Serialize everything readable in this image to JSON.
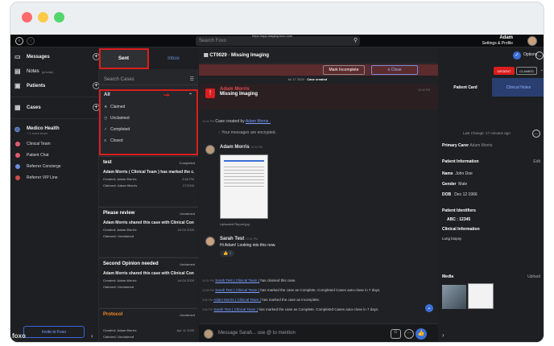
{
  "topbar": {
    "search_placeholder": "Search Foxo",
    "url": "https://app-staging.foxo.com",
    "user_name": "Adam",
    "user_sub": "Settings & Profile"
  },
  "sidebar": {
    "messages": "Messages",
    "notes": "Notes",
    "notes_sub": "(private)",
    "patients": "Patients",
    "cases": "Cases",
    "org_name": "Medico Health",
    "org_sub": "+ 1 more team",
    "teams": [
      {
        "label": "Clinical Team",
        "color": "#e45a6e"
      },
      {
        "label": "Patient Chat",
        "color": "#e45a6e"
      },
      {
        "label": "Referrer Concierge",
        "color": "#6b8de0"
      },
      {
        "label": "Referrer VIP Line",
        "color": "#d14a4a"
      }
    ],
    "invite": "Invite to Foxo",
    "logo": "foxo"
  },
  "cases": {
    "tab_sent": "Sent",
    "tab_inbox": "Inbox",
    "search_placeholder": "Search Cases",
    "filter_all": "All",
    "filters": [
      "Claimed",
      "Unclaimed",
      "Completed",
      "Closed"
    ],
    "cards": [
      {
        "title": "test",
        "status": "Completed",
        "msg": "Adam Morris ( Clinical Team ) has marked the c...",
        "created": "Created: Adam Morris",
        "claimed": "Claimed: Adam Morris",
        "time": "3:56 PM",
        "id": "CT0030"
      },
      {
        "title": "Please review",
        "status": "Unclaimed",
        "msg": "Adam Morris shared this case with Clinical Con...",
        "created": "Created: Adam Morris",
        "claimed": "Claimed: Unclaimed",
        "time": "Jul 04 2025",
        "id": ""
      },
      {
        "title": "Second Opinion needed",
        "status": "Unclaimed",
        "msg": "Adam Morris shared this case with Clinical Con...",
        "created": "Created: Adam Morris",
        "claimed": "Claimed: Unclaimed",
        "time": "Jul 04 2025",
        "id": ""
      },
      {
        "title": "Protocol",
        "status": "Unclaimed",
        "msg": "",
        "created": "Created: Adam Morris",
        "claimed": "Claimed: Unclaimed",
        "time": "Apr 11 2025",
        "id": ""
      }
    ]
  },
  "chat": {
    "title": "CT0029 · Missing Imaging",
    "options": "Options",
    "mark_incomplete": "Mark Incomplete",
    "close": "Close",
    "date_sep": "Jul 17 2025",
    "date_sep_label": "Case created",
    "m1_name": "Adam Morris",
    "m1_text": "Missing Imaging",
    "m1_time": "10:30 PM",
    "sys1_time": "10:32 PM",
    "sys1_text": "Case created by",
    "sys1_link": "Adam Morris .",
    "encrypted": "Your messages are encrypted.",
    "m2_name": "Adam Morris",
    "m2_time": "10:32 PM",
    "file_name": "Uploaded Report.jpg",
    "m3_name": "Sarah Test",
    "m3_time": "10:41 PM",
    "m3_text": "Hi Adam! Looking into this now.",
    "reaction_count": "1",
    "events": [
      {
        "time": "10:41 PM",
        "who": "Sarah Test ( Clinical Team )",
        "text": "has claimed this case."
      },
      {
        "time": "10:56 PM",
        "who": "Sarah Test ( Clinical Team )",
        "text": "has marked the case as Complete. Completed Cases auto-close in 7 days."
      },
      {
        "time": "3:56 PM",
        "who": "Adam Morris ( Clinical Team )",
        "text": "has marked the case as incomplete."
      },
      {
        "time": "3:56 PM",
        "who": "Sarah Test ( Clinical Team )",
        "text": "has marked the case as Complete. Completed Cases auto-close in 7 days."
      }
    ],
    "compose_placeholder": "Message Sarah... use @ to mention"
  },
  "patient": {
    "badge_urgent": "URGENT",
    "badge_claimed": "CLAIMED",
    "tab_card": "Patient Card",
    "tab_notes": "Clinical Notes",
    "last_change": "Last Change: 17 minutes ago",
    "carer_label": "Primary Carer",
    "carer_value": "Adam Morris",
    "info_title": "Patient Information",
    "edit": "Edit",
    "name_label": "Name",
    "name_value": "John Doe",
    "gender_label": "Gender",
    "gender_value": "Male",
    "dob_label": "DOB",
    "dob_value": "Dec 12 1966",
    "ids_title": "Patient Identifiers",
    "abc": "ABC : 12345",
    "clinical_title": "Clinical Information",
    "clinical_value": "Lung biopsy",
    "media_title": "Media",
    "upload": "Upload"
  }
}
